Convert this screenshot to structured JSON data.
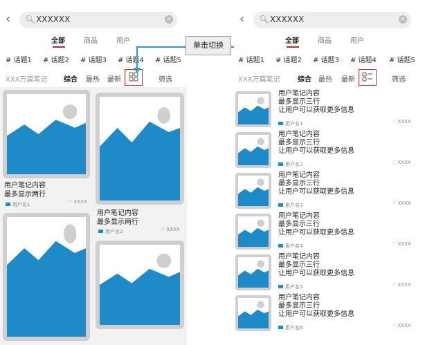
{
  "search": {
    "query": "XXXXXX"
  },
  "tabs": [
    "全部",
    "商品",
    "用户"
  ],
  "topics": [
    "# 话题1",
    "# 话题2",
    "# 话题3",
    "# 话题4",
    "# 话题5"
  ],
  "sortbar": {
    "count": "XXX万篇笔记",
    "options": [
      "综合",
      "最热",
      "最新"
    ],
    "filter": "筛选"
  },
  "switch_label": "单击切换",
  "grid_cards": [
    {
      "title": "用户笔记内容",
      "subtitle": "最多显示两行",
      "user": "用户名1",
      "likes": "♡ XXXX"
    },
    {
      "title": "用户笔记内容",
      "subtitle": "最多显示两行",
      "user": "用户名2",
      "likes": "♡ XXXX"
    }
  ],
  "list_items": [
    {
      "line1": "用户笔记内容",
      "line2": "最多显示三行",
      "line3": "让用户可以获取更多信息",
      "user": "用户名1",
      "likes": "♡ XXXX"
    },
    {
      "line1": "用户笔记内容",
      "line2": "最多显示三行",
      "line3": "让用户可以获取更多信息",
      "user": "用户名2",
      "likes": "♡ XXXX"
    },
    {
      "line1": "用户笔记内容",
      "line2": "最多显示三行",
      "line3": "让用户可以获取更多信息",
      "user": "用户名3",
      "likes": "♡ XXXX"
    },
    {
      "line1": "用户笔记内容",
      "line2": "最多显示三行",
      "line3": "让用户可以获取更多信息",
      "user": "用户名4",
      "likes": "♡ XXXX"
    },
    {
      "line1": "用户笔记内容",
      "line2": "最多显示三行",
      "line3": "让用户可以获取更多信息",
      "user": "用户名5",
      "likes": "♡ XXXX"
    },
    {
      "line1": "用户笔记内容",
      "line2": "最多显示三行",
      "line3": "让用户可以获取更多信息",
      "user": "用户名6",
      "likes": "♡ XXXX"
    }
  ],
  "colors": {
    "accent": "#e02020",
    "image_blue": "#1e8ac8",
    "frame_gray": "#cfcfcf",
    "switch_arrow": "#2a9bd6"
  }
}
